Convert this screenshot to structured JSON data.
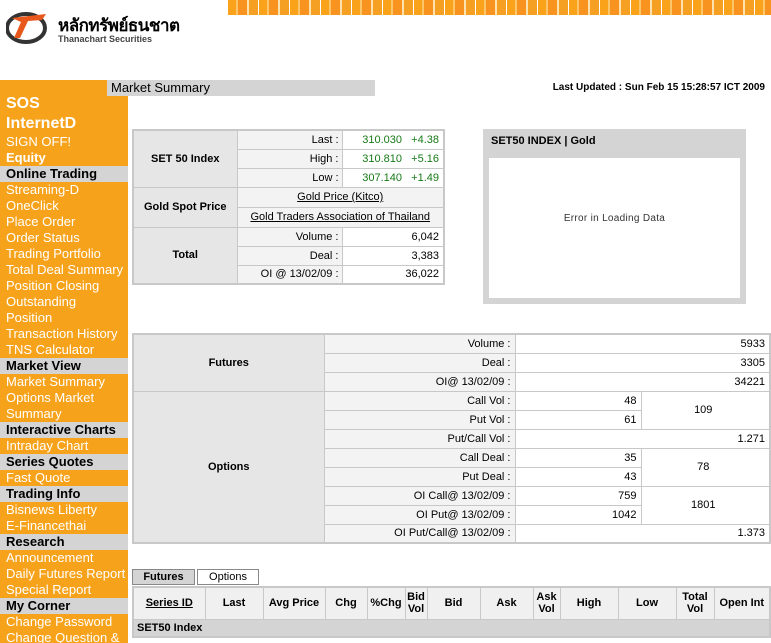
{
  "header": {
    "logo_thai": "หลักทรัพย์ธนชาต",
    "logo_en": "Thanachart Securities"
  },
  "page": {
    "title": "Market Summary",
    "last_updated_label": "Last Updated :",
    "last_updated_value": "Sun Feb 15 15:28:57 ICT 2009"
  },
  "sidebar": {
    "brand1": "SOS",
    "brand2": "InternetD",
    "sign_off": "SIGN OFF!",
    "equity": "Equity",
    "sections": [
      {
        "title": "Online Trading",
        "items": [
          "Streaming-D",
          "OneClick",
          "Place Order",
          "Order Status",
          "Trading Portfolio",
          "Total Deal Summary",
          "Position Closing",
          "Outstanding",
          "Position",
          "Transaction History",
          "TNS Calculator"
        ]
      },
      {
        "title": "Market View",
        "items": [
          "Market Summary",
          "Options Market",
          "Summary"
        ]
      },
      {
        "title": "Interactive Charts",
        "items": [
          "Intraday Chart"
        ]
      },
      {
        "title": "Series Quotes",
        "items": [
          "Fast Quote"
        ]
      },
      {
        "title": "Trading Info",
        "items": [
          "Bisnews Liberty",
          "E-Financethai"
        ]
      },
      {
        "title": "Research",
        "items": [
          "Announcement",
          "Daily Futures Report",
          "Special Report"
        ]
      },
      {
        "title": "My Corner",
        "items": [
          "Change Password",
          "Change Question &"
        ]
      }
    ]
  },
  "index_table": {
    "set50_label": "SET 50 Index",
    "last_label": "Last :",
    "last_value": "310.030",
    "last_chg": "+4.38",
    "high_label": "High :",
    "high_value": "310.810",
    "high_chg": "+5.16",
    "low_label": "Low :",
    "low_value": "307.140",
    "low_chg": "+1.49",
    "gold_label": "Gold Spot Price",
    "gold_link1": "Gold Price (Kitco)",
    "gold_link2": "Gold Traders Association of Thailand",
    "total_label": "Total",
    "volume_label": "Volume :",
    "volume_value": "6,042",
    "deal_label": "Deal :",
    "deal_value": "3,383",
    "oi_label": "OI @ 13/02/09 :",
    "oi_value": "36,022"
  },
  "chart_box": {
    "title": "SET50 INDEX | Gold",
    "error": "Error in Loading Data"
  },
  "summary": {
    "futures_label": "Futures",
    "f_volume_label": "Volume :",
    "f_volume": "5933",
    "f_deal_label": "Deal :",
    "f_deal": "3305",
    "f_oi_label": "OI@ 13/02/09 :",
    "f_oi": "34221",
    "options_label": "Options",
    "call_vol_label": "Call Vol :",
    "call_vol": "48",
    "put_vol_label": "Put Vol :",
    "put_vol": "61",
    "vol_total": "109",
    "pc_vol_label": "Put/Call Vol :",
    "pc_vol": "1.271",
    "call_deal_label": "Call Deal :",
    "call_deal": "35",
    "put_deal_label": "Put Deal :",
    "put_deal": "43",
    "deal_total": "78",
    "oi_call_label": "OI Call@ 13/02/09 :",
    "oi_call": "759",
    "oi_put_label": "OI Put@ 13/02/09 :",
    "oi_put": "1042",
    "oi_total": "1801",
    "oi_pc_label": "OI Put/Call@ 13/02/09 :",
    "oi_pc": "1.373"
  },
  "tabs": {
    "futures": "Futures",
    "options": "Options"
  },
  "quote_table": {
    "headers": [
      "Series ID",
      "Last",
      "Avg Price",
      "Chg",
      "%Chg",
      "Bid Vol",
      "Bid",
      "Ask",
      "Ask Vol",
      "High",
      "Low",
      "Total Vol",
      "Open Int"
    ],
    "section": "SET50 Index"
  },
  "colors": {
    "sidebar_orange": "#f7a21b",
    "section_gray": "#d4d4d4",
    "change_green": "#167a16"
  }
}
